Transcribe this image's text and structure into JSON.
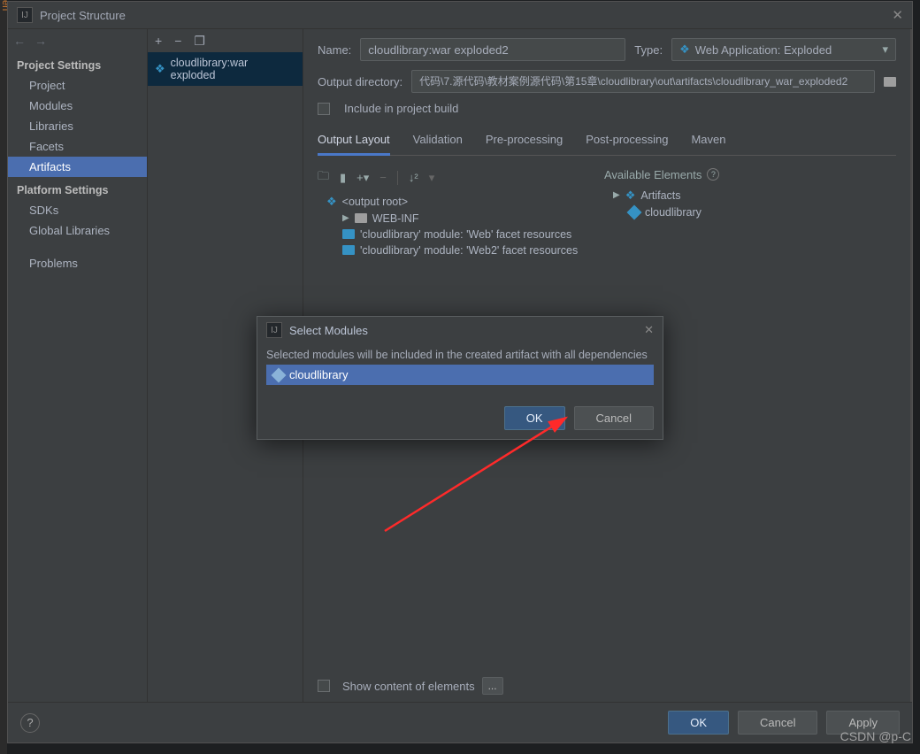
{
  "left_edge_hint": "en",
  "window": {
    "title": "Project Structure",
    "close_glyph": "✕"
  },
  "sidebar": {
    "nav_back": "←",
    "nav_fwd": "→",
    "sections": {
      "project_settings": "Project Settings",
      "platform_settings": "Platform Settings"
    },
    "items": {
      "project": "Project",
      "modules": "Modules",
      "libraries": "Libraries",
      "facets": "Facets",
      "artifacts": "Artifacts",
      "sdks": "SDKs",
      "global_libraries": "Global Libraries",
      "problems": "Problems"
    }
  },
  "midlist": {
    "add_glyph": "+",
    "remove_glyph": "−",
    "copy_glyph": "❐",
    "item0": "cloudlibrary:war exploded"
  },
  "main": {
    "name_label": "Name:",
    "name_value": "cloudlibrary:war exploded2",
    "type_label": "Type:",
    "type_value": "Web Application: Exploded",
    "outdir_label": "Output directory:",
    "outdir_value": "代码\\7.源代码\\教材案例源代码\\第15章\\cloudlibrary\\out\\artifacts\\cloudlibrary_war_exploded2",
    "include_label": "Include in project build",
    "tabs": {
      "output_layout": "Output Layout",
      "validation": "Validation",
      "pre": "Pre-processing",
      "post": "Post-processing",
      "maven": "Maven"
    },
    "output_tree": {
      "root": "<output root>",
      "webinf": "WEB-INF",
      "facet1": "'cloudlibrary' module: 'Web' facet resources",
      "facet2": "'cloudlibrary' module: 'Web2' facet resources"
    },
    "available": {
      "header": "Available Elements",
      "artifacts": "Artifacts",
      "module": "cloudlibrary"
    },
    "show_content_label": "Show content of elements",
    "ellipsis": "..."
  },
  "modal": {
    "title": "Select Modules",
    "desc": "Selected modules will be included in the created artifact with all dependencies",
    "item": "cloudlibrary",
    "ok": "OK",
    "cancel": "Cancel",
    "close_glyph": "✕"
  },
  "footer": {
    "help": "?",
    "ok": "OK",
    "cancel": "Cancel",
    "apply": "Apply"
  },
  "watermark": "CSDN @p-C"
}
